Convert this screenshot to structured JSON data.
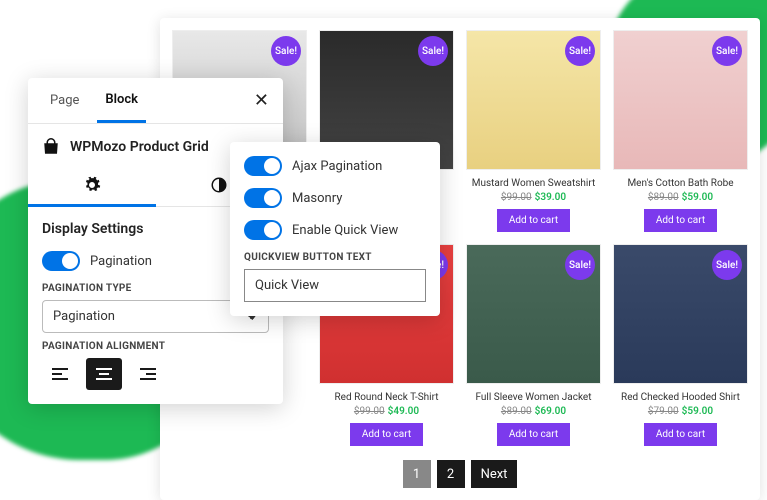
{
  "tabs": {
    "page": "Page",
    "block": "Block"
  },
  "widget": {
    "name": "WPMozo Product Grid"
  },
  "section": {
    "title": "Display Settings",
    "pagination_toggle": "Pagination",
    "pagination_type_label": "PAGINATION TYPE",
    "pagination_type_value": "Pagination",
    "pagination_alignment_label": "PAGINATION ALIGNMENT"
  },
  "panel2": {
    "ajax": "Ajax Pagination",
    "masonry": "Masonry",
    "quickview": "Enable Quick View",
    "qv_label": "QUICKVIEW BUTTON TEXT",
    "qv_value": "Quick View"
  },
  "sale": "Sale!",
  "add_to_cart": "Add to cart",
  "products": [
    {
      "title": "",
      "old": "",
      "new": ""
    },
    {
      "title": "",
      "old": "",
      "new": ""
    },
    {
      "title": "Mustard Women Sweatshirt",
      "old": "$99.00",
      "new": "$39.00"
    },
    {
      "title": "Men's Cotton Bath Robe",
      "old": "$89.00",
      "new": "$59.00"
    },
    {
      "title": "Red Round Neck T-Shirt",
      "old": "$99.00",
      "new": "$49.00"
    },
    {
      "title": "Full Sleeve Women Jacket",
      "old": "$89.00",
      "new": "$69.00"
    },
    {
      "title": "Red Checked Hooded Shirt",
      "old": "$79.00",
      "new": "$59.00"
    }
  ],
  "pagination": {
    "p1": "1",
    "p2": "2",
    "next": "Next"
  }
}
